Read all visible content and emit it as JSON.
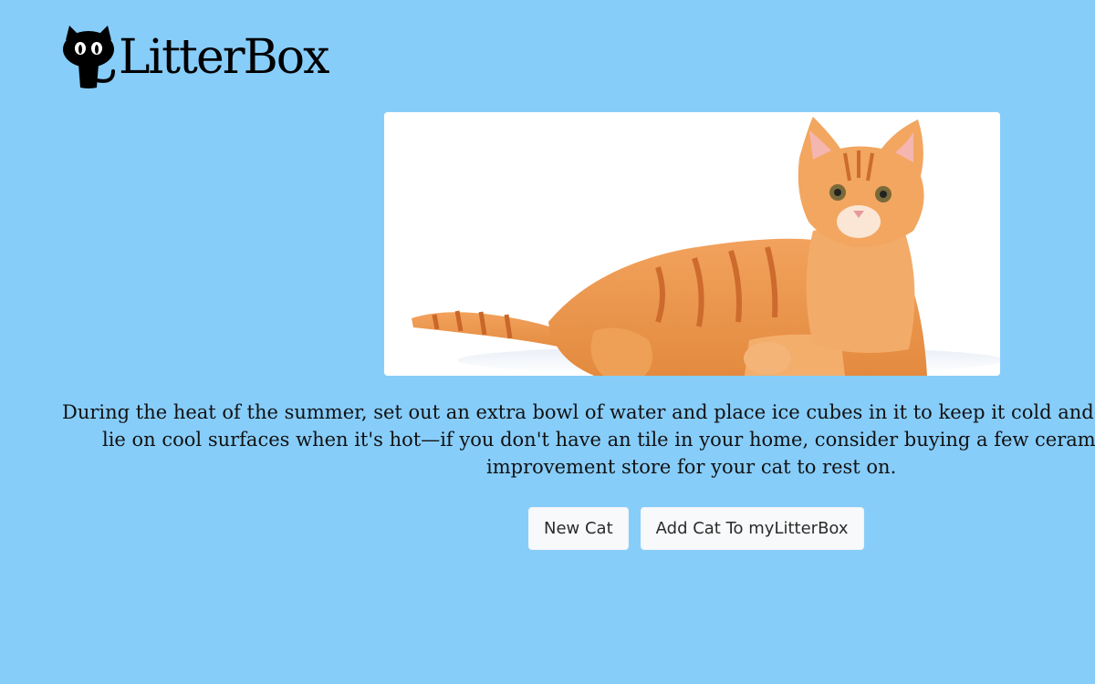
{
  "brand": {
    "name": "LitterBox",
    "logo_icon": "black-cat-icon"
  },
  "hero": {
    "image_icon": "orange-tabby-cat-photo"
  },
  "fact": {
    "line1": "During the heat of the summer, set out an extra bowl of water and place ice cubes in it to keep it cold and",
    "line2": "lie on cool surfaces when it's hot—if you don't have an tile in your home, consider buying a few cerami",
    "line3": "improvement store for your cat to rest on."
  },
  "actions": {
    "new_cat_label": "New Cat",
    "add_cat_label": "Add Cat To myLitterBox"
  },
  "colors": {
    "background": "#87cdfa",
    "button_bg": "#f8f9fa",
    "text": "#111111"
  }
}
